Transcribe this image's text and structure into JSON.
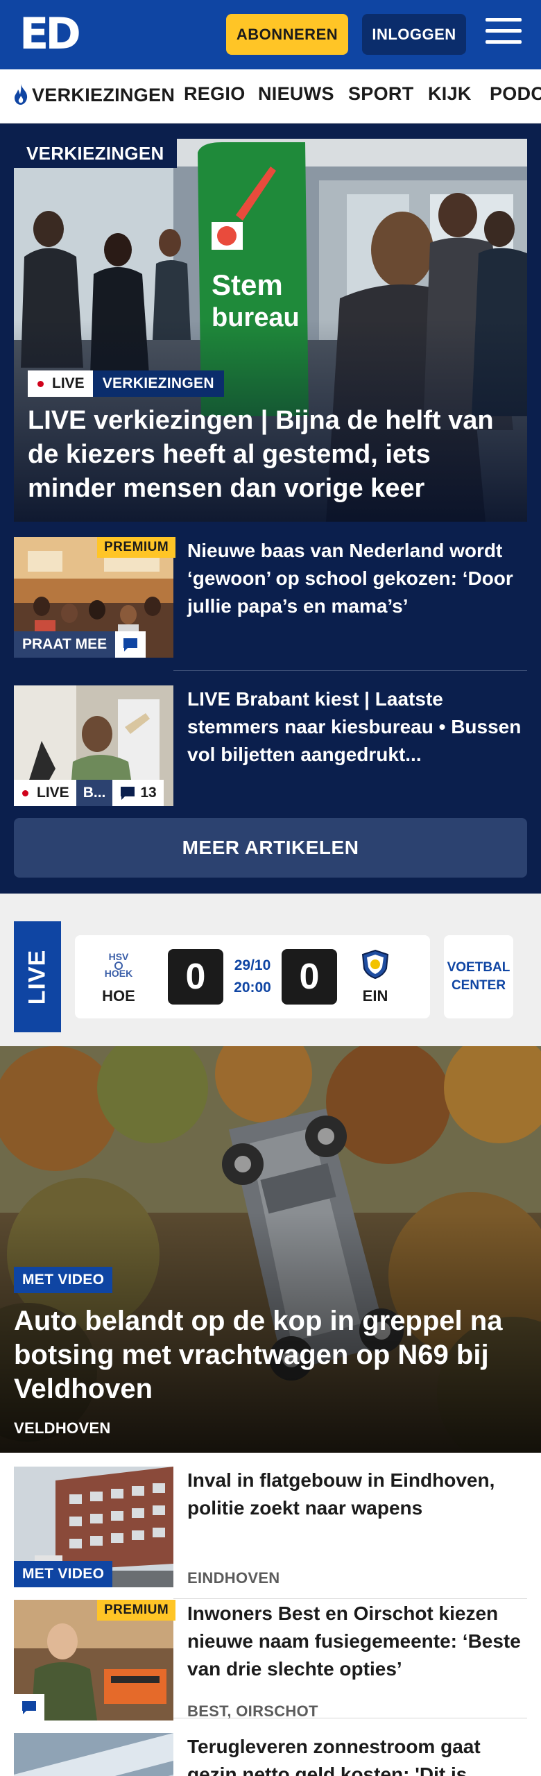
{
  "header": {
    "logo": "ED",
    "subscribe_label": "ABONNEREN",
    "login_label": "INLOGGEN"
  },
  "nav": {
    "items": [
      "VERKIEZINGEN",
      "REGIO",
      "NIEUWS",
      "SPORT",
      "KIJK",
      "PODCASTS"
    ]
  },
  "election": {
    "section_label": "VERKIEZINGEN",
    "hero": {
      "live_label": "LIVE",
      "category": "VERKIEZINGEN",
      "title": "LIVE verkiezingen | Bijna de helft van de kiezers heeft al gestemd, iets minder mensen dan vorige keer",
      "banner_text_1": "Stem",
      "banner_text_2": "bureau"
    },
    "articles": [
      {
        "badge": "PREMIUM",
        "tag": "PRAAT MEE",
        "title": "Nieuwe baas van Nederland wordt ‘gewoon’ op school gekozen: ‘Door jullie papa’s en mama’s’"
      },
      {
        "live_label": "LIVE",
        "tag": "B...",
        "comments": "13",
        "title": "LIVE Brabant kiest | Laatste stemmers naar kiesbureau • Bussen vol biljetten aangedrukt..."
      }
    ],
    "more_label": "MEER ARTIKELEN"
  },
  "score": {
    "live_label": "LIVE",
    "home": {
      "abbr": "HOE",
      "logo_text_1": "HSV",
      "logo_text_2": "HOEK",
      "goals": "0"
    },
    "away": {
      "abbr": "EIN",
      "goals": "0"
    },
    "date": "29/10",
    "time": "20:00",
    "center_label_1": "VOETBAL",
    "center_label_2": "CENTER"
  },
  "car_story": {
    "video_label": "MET VIDEO",
    "title": "Auto belandt op de kop in greppel na botsing met vrachtwagen op N69 bij Veldhoven",
    "location": "VELDHOVEN"
  },
  "list": [
    {
      "video_label": "MET VIDEO",
      "title": "Inval in flatgebouw in Eindhoven, politie zoekt naar wapens",
      "location": "EINDHOVEN"
    },
    {
      "badge": "PREMIUM",
      "title": "Inwoners Best en Oirschot kiezen nieuwe naam fusiegemeente: ‘Beste van drie slechte opties’",
      "location": "BEST, OIRSCHOT"
    },
    {
      "title": "Terugleveren zonnestroom gaat gezin netto geld kosten: 'Dit is"
    }
  ],
  "colors": {
    "brand_blue": "#0f45a3",
    "dark_navy": "#0b1f4d",
    "premium_yellow": "#ffc526",
    "live_red": "#d0021b"
  }
}
